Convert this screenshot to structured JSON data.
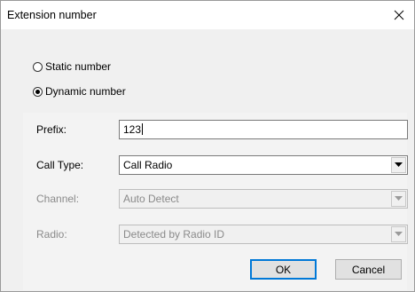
{
  "window": {
    "title": "Extension number",
    "close_icon": "close-icon"
  },
  "number_type": {
    "options": [
      {
        "label": "Static number",
        "checked": false
      },
      {
        "label": "Dynamic number",
        "checked": true
      }
    ]
  },
  "fields": {
    "prefix": {
      "label": "Prefix:",
      "value": "123"
    },
    "call_type": {
      "label": "Call Type:",
      "value": "Call Radio"
    },
    "channel": {
      "label": "Channel:",
      "value": "Auto Detect"
    },
    "radio": {
      "label": "Radio:",
      "value": "Detected by Radio ID"
    }
  },
  "buttons": {
    "ok": "OK",
    "cancel": "Cancel"
  }
}
